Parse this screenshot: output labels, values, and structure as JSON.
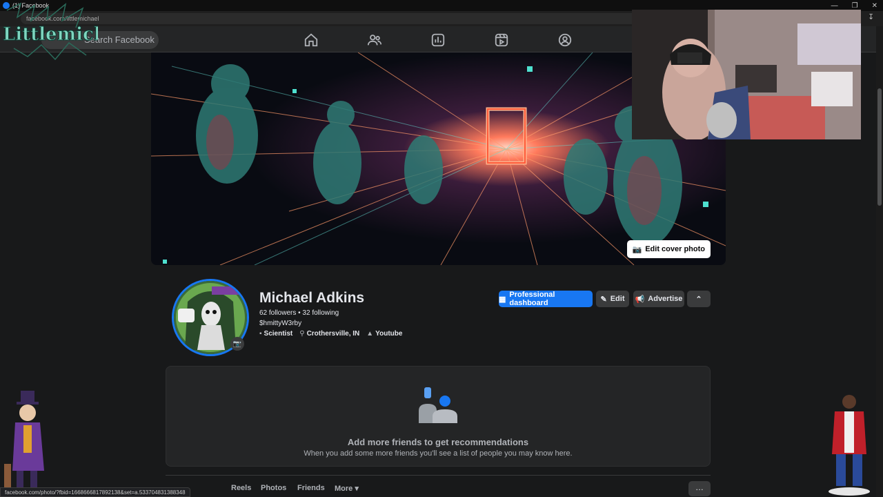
{
  "browser": {
    "tab_title": "(1) Facebook",
    "url": "facebook.com/littlemichael"
  },
  "fbnav": {
    "search_placeholder": "Search Facebook"
  },
  "overlay_logo": {
    "text": "Littlemichael"
  },
  "cover": {
    "edit_label": "Edit cover photo"
  },
  "profile": {
    "name": "Michael Adkins",
    "followers": "62 followers",
    "following": "32 following",
    "separator": " • ",
    "username": "$hmittyW3rby",
    "details": [
      {
        "icon": "briefcase-icon",
        "label": "Scientist"
      },
      {
        "icon": "location-pin-icon",
        "label": "Crothersville, IN"
      },
      {
        "icon": "youtube-icon",
        "label": "Youtube"
      }
    ]
  },
  "actions": {
    "dashboard": "Professional dashboard",
    "edit": "Edit",
    "advertise": "Advertise"
  },
  "recommendations": {
    "title": "Add more friends to get recommendations",
    "subtitle": "When you add some more friends you'll see a list of people you may know here."
  },
  "tabs": {
    "reels": "Reels",
    "photos": "Photos",
    "friends": "Friends",
    "more": "More"
  },
  "status_url": "facebook.com/photo/?fbid=1668666817892138&set=a.533704831388348",
  "colors": {
    "accent": "#1877f2",
    "background": "#18191a",
    "surface": "#242526"
  }
}
